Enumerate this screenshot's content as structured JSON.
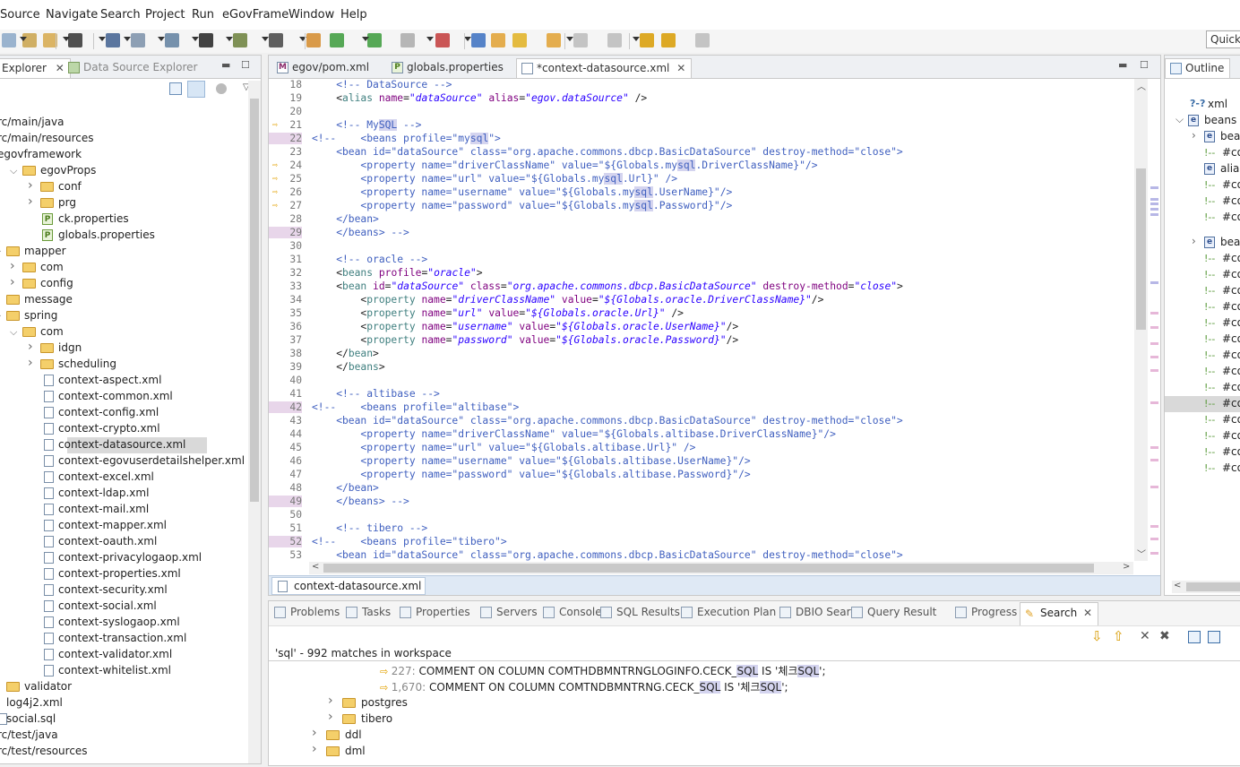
{
  "menu": [
    "Source",
    "Navigate",
    "Search",
    "Project",
    "Run",
    "eGovFrame",
    "Window",
    "Help"
  ],
  "quick_access_placeholder": "Quick",
  "explorer": {
    "tabs": [
      {
        "label": "Explorer"
      },
      {
        "label": "Data Source Explorer"
      }
    ],
    "tree": [
      {
        "label": "rc/main/java",
        "type": "pkg",
        "indent": 0,
        "twisty": ""
      },
      {
        "label": "rc/main/resources",
        "type": "pkg",
        "indent": 0,
        "twisty": ""
      },
      {
        "label": "egovframework",
        "type": "pkg",
        "indent": 0,
        "twisty": ""
      },
      {
        "label": "egovProps",
        "type": "folder",
        "indent": 1,
        "twisty": "v"
      },
      {
        "label": "conf",
        "type": "folder",
        "indent": 2,
        "twisty": ">"
      },
      {
        "label": "prg",
        "type": "folder",
        "indent": 2,
        "twisty": ">"
      },
      {
        "label": "ck.properties",
        "type": "prop",
        "indent": 2,
        "twisty": ""
      },
      {
        "label": "globals.properties",
        "type": "prop",
        "indent": 2,
        "twisty": ""
      },
      {
        "label": "mapper",
        "type": "folder",
        "indent": 0,
        "twisty": "v"
      },
      {
        "label": "com",
        "type": "folder",
        "indent": 1,
        "twisty": ">"
      },
      {
        "label": "config",
        "type": "folder",
        "indent": 1,
        "twisty": ">"
      },
      {
        "label": "message",
        "type": "folder",
        "indent": 0,
        "twisty": ">"
      },
      {
        "label": "spring",
        "type": "folder",
        "indent": 0,
        "twisty": "v"
      },
      {
        "label": "com",
        "type": "folder",
        "indent": 1,
        "twisty": "v"
      },
      {
        "label": "idgn",
        "type": "folder",
        "indent": 2,
        "twisty": ">"
      },
      {
        "label": "scheduling",
        "type": "folder",
        "indent": 2,
        "twisty": ">"
      },
      {
        "label": "context-aspect.xml",
        "type": "xml",
        "indent": 2,
        "twisty": ""
      },
      {
        "label": "context-common.xml",
        "type": "xml",
        "indent": 2,
        "twisty": ""
      },
      {
        "label": "context-config.xml",
        "type": "xml",
        "indent": 2,
        "twisty": ""
      },
      {
        "label": "context-crypto.xml",
        "type": "xml",
        "indent": 2,
        "twisty": ""
      },
      {
        "label": "context-datasource.xml",
        "type": "xml",
        "indent": 2,
        "twisty": "",
        "selected": true
      },
      {
        "label": "context-egovuserdetailshelper.xml",
        "type": "xml",
        "indent": 2,
        "twisty": ""
      },
      {
        "label": "context-excel.xml",
        "type": "xml",
        "indent": 2,
        "twisty": ""
      },
      {
        "label": "context-ldap.xml",
        "type": "xml",
        "indent": 2,
        "twisty": ""
      },
      {
        "label": "context-mail.xml",
        "type": "xml",
        "indent": 2,
        "twisty": ""
      },
      {
        "label": "context-mapper.xml",
        "type": "xml",
        "indent": 2,
        "twisty": ""
      },
      {
        "label": "context-oauth.xml",
        "type": "xml",
        "indent": 2,
        "twisty": ""
      },
      {
        "label": "context-privacylogaop.xml",
        "type": "xml",
        "indent": 2,
        "twisty": ""
      },
      {
        "label": "context-properties.xml",
        "type": "xml",
        "indent": 2,
        "twisty": ""
      },
      {
        "label": "context-security.xml",
        "type": "xml",
        "indent": 2,
        "twisty": ""
      },
      {
        "label": "context-social.xml",
        "type": "xml",
        "indent": 2,
        "twisty": ""
      },
      {
        "label": "context-syslogaop.xml",
        "type": "xml",
        "indent": 2,
        "twisty": ""
      },
      {
        "label": "context-transaction.xml",
        "type": "xml",
        "indent": 2,
        "twisty": ""
      },
      {
        "label": "context-validator.xml",
        "type": "xml",
        "indent": 2,
        "twisty": ""
      },
      {
        "label": "context-whitelist.xml",
        "type": "xml",
        "indent": 2,
        "twisty": ""
      },
      {
        "label": "validator",
        "type": "folder",
        "indent": 0,
        "twisty": ">"
      },
      {
        "label": "log4j2.xml",
        "type": "xml",
        "indent": 0,
        "twisty": ""
      },
      {
        "label": "social.sql",
        "type": "file",
        "indent": 0,
        "twisty": ""
      },
      {
        "label": "rc/test/java",
        "type": "pkg",
        "indent": 0,
        "twisty": ""
      },
      {
        "label": "rc/test/resources",
        "type": "pkg",
        "indent": 0,
        "twisty": ""
      }
    ]
  },
  "editor": {
    "tabs": [
      {
        "label": "egov/pom.xml",
        "icon": "M",
        "active": false
      },
      {
        "label": "globals.properties",
        "icon": "P",
        "active": false
      },
      {
        "label": "*context-datasource.xml",
        "icon": "X",
        "active": true
      }
    ],
    "breadcrumb": "context-datasource.xml",
    "lines": [
      {
        "n": "18",
        "html": "<span class=\"c-com\">    &lt;!-- DataSource --&gt;</span>"
      },
      {
        "n": "19",
        "html": "    &lt;<span class=\"c-tag\">alias</span> <span class=\"c-attr\">name</span>=<span class=\"c-val\">\"dataSource\"</span> <span class=\"c-attr\">alias</span>=<span class=\"c-val\">\"egov.dataSource\"</span> /&gt;"
      },
      {
        "n": "20",
        "html": ""
      },
      {
        "n": "21",
        "arrow": true,
        "html": "<span class=\"c-com\">    &lt;!-- My<span class=\"hl\">SQL</span> --&gt;</span>"
      },
      {
        "n": "22",
        "arrow": true,
        "mark": true,
        "html": "<span class=\"c-com\">&lt;!--    &lt;beans profile=\"my<span class=\"hl\">sql</span>\"&gt;</span>"
      },
      {
        "n": "23",
        "html": "<span class=\"c-com\">    &lt;bean id=\"dataSource\" class=\"org.apache.commons.dbcp.BasicDataSource\" destroy-method=\"close\"&gt;</span>"
      },
      {
        "n": "24",
        "arrow": true,
        "html": "<span class=\"c-com\">        &lt;property name=\"driverClassName\" value=\"${Globals.my<span class=\"hl\">sql</span>.DriverClassName}\"/&gt;</span>"
      },
      {
        "n": "25",
        "arrow": true,
        "html": "<span class=\"c-com\">        &lt;property name=\"url\" value=\"${Globals.my<span class=\"hl\">sql</span>.Url}\" /&gt;</span>"
      },
      {
        "n": "26",
        "arrow": true,
        "html": "<span class=\"c-com\">        &lt;property name=\"username\" value=\"${Globals.my<span class=\"hl\">sql</span>.UserName}\"/&gt;</span>"
      },
      {
        "n": "27",
        "arrow": true,
        "html": "<span class=\"c-com\">        &lt;property name=\"password\" value=\"${Globals.my<span class=\"hl\">sql</span>.Password}\"/&gt;</span>"
      },
      {
        "n": "28",
        "html": "<span class=\"c-com\">    &lt;/bean&gt;</span>"
      },
      {
        "n": "29",
        "mark": true,
        "html": "<span class=\"c-com\">    &lt;/beans&gt; --&gt;</span>"
      },
      {
        "n": "30",
        "html": ""
      },
      {
        "n": "31",
        "html": "<span class=\"c-com\">    &lt;!-- oracle --&gt;</span>"
      },
      {
        "n": "32",
        "html": "    &lt;<span class=\"c-tag\">beans</span> <span class=\"c-attr\">profile</span>=<span class=\"c-val\">\"oracle\"</span>&gt;"
      },
      {
        "n": "33",
        "html": "    &lt;<span class=\"c-tag\">bean</span> <span class=\"c-attr\">id</span>=<span class=\"c-val\">\"dataSource\"</span> <span class=\"c-attr\">class</span>=<span class=\"c-val\">\"org.apache.commons.dbcp.BasicDataSource\"</span> <span class=\"c-attr\">destroy-method</span>=<span class=\"c-val\">\"close\"</span>&gt;"
      },
      {
        "n": "34",
        "html": "        &lt;<span class=\"c-tag\">property</span> <span class=\"c-attr\">name</span>=<span class=\"c-val\">\"driverClassName\"</span> <span class=\"c-attr\">value</span>=<span class=\"c-val\">\"${Globals.oracle.DriverClassName}\"</span>/&gt;"
      },
      {
        "n": "35",
        "html": "        &lt;<span class=\"c-tag\">property</span> <span class=\"c-attr\">name</span>=<span class=\"c-val\">\"url\"</span> <span class=\"c-attr\">value</span>=<span class=\"c-val\">\"${Globals.oracle.Url}\"</span> /&gt;"
      },
      {
        "n": "36",
        "html": "        &lt;<span class=\"c-tag\">property</span> <span class=\"c-attr\">name</span>=<span class=\"c-val\">\"username\"</span> <span class=\"c-attr\">value</span>=<span class=\"c-val\">\"${Globals.oracle.UserName}\"</span>/&gt;"
      },
      {
        "n": "37",
        "html": "        &lt;<span class=\"c-tag\">property</span> <span class=\"c-attr\">name</span>=<span class=\"c-val\">\"password\"</span> <span class=\"c-attr\">value</span>=<span class=\"c-val\">\"${Globals.oracle.Password}\"</span>/&gt;"
      },
      {
        "n": "38",
        "html": "    &lt;/<span class=\"c-tag\">bean</span>&gt;"
      },
      {
        "n": "39",
        "html": "    &lt;/<span class=\"c-tag\">beans</span>&gt;"
      },
      {
        "n": "40",
        "html": ""
      },
      {
        "n": "41",
        "html": "<span class=\"c-com\">    &lt;!-- altibase --&gt;</span>"
      },
      {
        "n": "42",
        "mark": true,
        "html": "<span class=\"c-com\">&lt;!--    &lt;beans profile=\"altibase\"&gt;</span>"
      },
      {
        "n": "43",
        "html": "<span class=\"c-com\">    &lt;bean id=\"dataSource\" class=\"org.apache.commons.dbcp.BasicDataSource\" destroy-method=\"close\"&gt;</span>"
      },
      {
        "n": "44",
        "html": "<span class=\"c-com\">        &lt;property name=\"driverClassName\" value=\"${Globals.altibase.DriverClassName}\"/&gt;</span>"
      },
      {
        "n": "45",
        "html": "<span class=\"c-com\">        &lt;property name=\"url\" value=\"${Globals.altibase.Url}\" /&gt;</span>"
      },
      {
        "n": "46",
        "html": "<span class=\"c-com\">        &lt;property name=\"username\" value=\"${Globals.altibase.UserName}\"/&gt;</span>"
      },
      {
        "n": "47",
        "html": "<span class=\"c-com\">        &lt;property name=\"password\" value=\"${Globals.altibase.Password}\"/&gt;</span>"
      },
      {
        "n": "48",
        "html": "<span class=\"c-com\">    &lt;/bean&gt;</span>"
      },
      {
        "n": "49",
        "mark": true,
        "html": "<span class=\"c-com\">    &lt;/beans&gt; --&gt;</span>"
      },
      {
        "n": "50",
        "html": ""
      },
      {
        "n": "51",
        "html": "<span class=\"c-com\">    &lt;!-- tibero --&gt;</span>"
      },
      {
        "n": "52",
        "mark": true,
        "html": "<span class=\"c-com\">&lt;!--    &lt;beans profile=\"tibero\"&gt;</span>"
      },
      {
        "n": "53",
        "html": "<span class=\"c-com\">    &lt;bean id=\"dataSource\" class=\"org.apache.commons.dbcp.BasicDataSource\" destroy-method=\"close\"&gt;</span>"
      }
    ]
  },
  "outline": {
    "title": "Outline",
    "rows": [
      {
        "label": "xml",
        "kind": "pi",
        "indent": 0,
        "twisty": ""
      },
      {
        "label": "beans",
        "kind": "e",
        "indent": 0,
        "twisty": "v"
      },
      {
        "label": "bea",
        "kind": "e",
        "indent": 1,
        "twisty": ">"
      },
      {
        "label": "#co",
        "kind": "c",
        "indent": 1,
        "twisty": ""
      },
      {
        "label": "alia",
        "kind": "e",
        "indent": 1,
        "twisty": ""
      },
      {
        "label": "#co",
        "kind": "c",
        "indent": 1,
        "twisty": ""
      },
      {
        "label": "#co",
        "kind": "c",
        "indent": 1,
        "twisty": ""
      },
      {
        "label": "#co",
        "kind": "c",
        "indent": 1,
        "twisty": ""
      },
      {
        "label": "bea",
        "kind": "e",
        "indent": 1,
        "twisty": ">"
      },
      {
        "label": "#co",
        "kind": "c",
        "indent": 1,
        "twisty": ""
      },
      {
        "label": "#co",
        "kind": "c",
        "indent": 1,
        "twisty": ""
      },
      {
        "label": "#co",
        "kind": "c",
        "indent": 1,
        "twisty": ""
      },
      {
        "label": "#co",
        "kind": "c",
        "indent": 1,
        "twisty": ""
      },
      {
        "label": "#co",
        "kind": "c",
        "indent": 1,
        "twisty": ""
      },
      {
        "label": "#co",
        "kind": "c",
        "indent": 1,
        "twisty": ""
      },
      {
        "label": "#co",
        "kind": "c",
        "indent": 1,
        "twisty": ""
      },
      {
        "label": "#co",
        "kind": "c",
        "indent": 1,
        "twisty": ""
      },
      {
        "label": "#co",
        "kind": "c",
        "indent": 1,
        "twisty": ""
      },
      {
        "label": "#co",
        "kind": "c",
        "indent": 1,
        "twisty": "",
        "selected": true
      },
      {
        "label": "#co",
        "kind": "c",
        "indent": 1,
        "twisty": ""
      },
      {
        "label": "#co",
        "kind": "c",
        "indent": 1,
        "twisty": ""
      },
      {
        "label": "#co",
        "kind": "c",
        "indent": 1,
        "twisty": ""
      },
      {
        "label": "#co",
        "kind": "c",
        "indent": 1,
        "twisty": ""
      }
    ]
  },
  "bottom": {
    "tabs": [
      "Problems",
      "Tasks",
      "Properties",
      "Servers",
      "Console",
      "SQL Results",
      "Execution Plan",
      "DBIO Search",
      "Query Result",
      "Progress",
      "Search"
    ],
    "active_tab": "Search",
    "summary": "'sql' - 992 matches in workspace",
    "results": [
      {
        "num": "227:",
        "pre": " COMMENT ON COLUMN COMTHDBMNTRNGLOGINFO.CECK_",
        "m1": "SQL",
        "mid": " IS '체크",
        "m2": "SQL",
        "post": "';"
      },
      {
        "num": "1,670:",
        "pre": " COMMENT ON COLUMN COMTNDBMNTRNG.CECK_",
        "m1": "SQL",
        "mid": " IS '체크",
        "m2": "SQL",
        "post": "';"
      }
    ],
    "folders": [
      {
        "label": "postgres",
        "indent": 1
      },
      {
        "label": "tibero",
        "indent": 1
      },
      {
        "label": "ddl",
        "indent": 0
      },
      {
        "label": "dml",
        "indent": 0
      }
    ]
  },
  "colors": {
    "accent": "#3f5fbf",
    "selection": "#d9d9d9",
    "highlight": "#d4d4ef",
    "marker": "#e8d6ea"
  }
}
